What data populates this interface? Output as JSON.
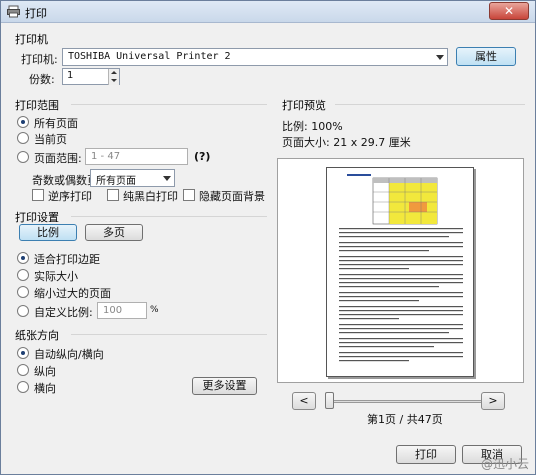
{
  "window": {
    "title": "打印"
  },
  "printer": {
    "section": "打印机",
    "label": "打印机:",
    "selected": "TOSHIBA Universal Printer 2",
    "properties_button": "属性",
    "copies_label": "份数:",
    "copies_value": "1"
  },
  "range": {
    "section": "打印范围",
    "all_pages": "所有页面",
    "current_page": "当前页",
    "page_range": "页面范围:",
    "page_range_placeholder": "1 - 47",
    "help": "(?)",
    "odd_even_label": "奇数或偶数页",
    "odd_even_value": "所有页面",
    "reverse": "逆序打印",
    "bw": "纯黑白打印",
    "hide_bg": "隐藏页面背景"
  },
  "settings": {
    "section": "打印设置",
    "tab_scale": "比例",
    "tab_multi": "多页",
    "fit_margin": "适合打印边距",
    "actual_size": "实际大小",
    "shrink": "缩小过大的页面",
    "custom": "自定义比例:",
    "custom_value": "100",
    "percent": "%"
  },
  "orientation": {
    "section": "纸张方向",
    "auto": "自动纵向/横向",
    "portrait": "纵向",
    "landscape": "横向",
    "more_button": "更多设置"
  },
  "preview": {
    "section": "打印预览",
    "scale_label": "比例:  100%",
    "page_size_label": "页面大小:  21 x 29.7 厘米",
    "prev": "<",
    "next": ">",
    "page_status": "第1页 / 共47页"
  },
  "footer": {
    "print_button": "打印",
    "cancel_button": "取消",
    "watermark": "@迅小云"
  }
}
